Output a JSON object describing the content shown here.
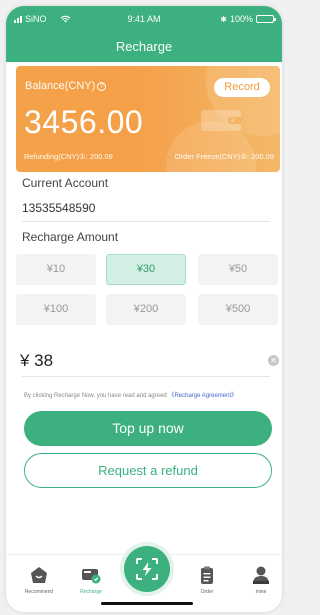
{
  "status_bar": {
    "carrier": "SiNO",
    "time": "9:41 AM",
    "battery": "100%"
  },
  "header": {
    "title": "Recharge"
  },
  "balance_card": {
    "label": "Balance(CNY)",
    "record_label": "Record",
    "amount": "3456.00",
    "refunding": "Refunding(CNY)①: 200.09",
    "order_freeze": "Order Freeze(CNY)②: 200.09"
  },
  "account": {
    "label": "Current Account",
    "number": "13535548590"
  },
  "recharge": {
    "label": "Recharge Amount",
    "options": [
      "¥10",
      "¥30",
      "¥50",
      "¥100",
      "¥200",
      "¥500"
    ],
    "selected": "¥30",
    "custom_value": "¥ 38"
  },
  "agreement": {
    "text": "By clicking Recharge Now, you have read and agreed",
    "link": "《Recharge Agreement》"
  },
  "actions": {
    "topup_label": "Top up now",
    "refund_label": "Request a refund"
  },
  "tab_bar": {
    "items": [
      {
        "label": "Recommend",
        "icon": "home-icon",
        "active": false
      },
      {
        "label": "Recharge",
        "icon": "wallet-icon",
        "active": true
      },
      {
        "label": "Order",
        "icon": "clipboard-icon",
        "active": false
      },
      {
        "label": "mine",
        "icon": "person-icon",
        "active": false
      }
    ],
    "center_icon": "scan-lightning-icon"
  },
  "colors": {
    "primary": "#3cb07f",
    "card_orange": "#f3a24a",
    "selected_bg": "#d3efe3",
    "link": "#4068c8"
  }
}
